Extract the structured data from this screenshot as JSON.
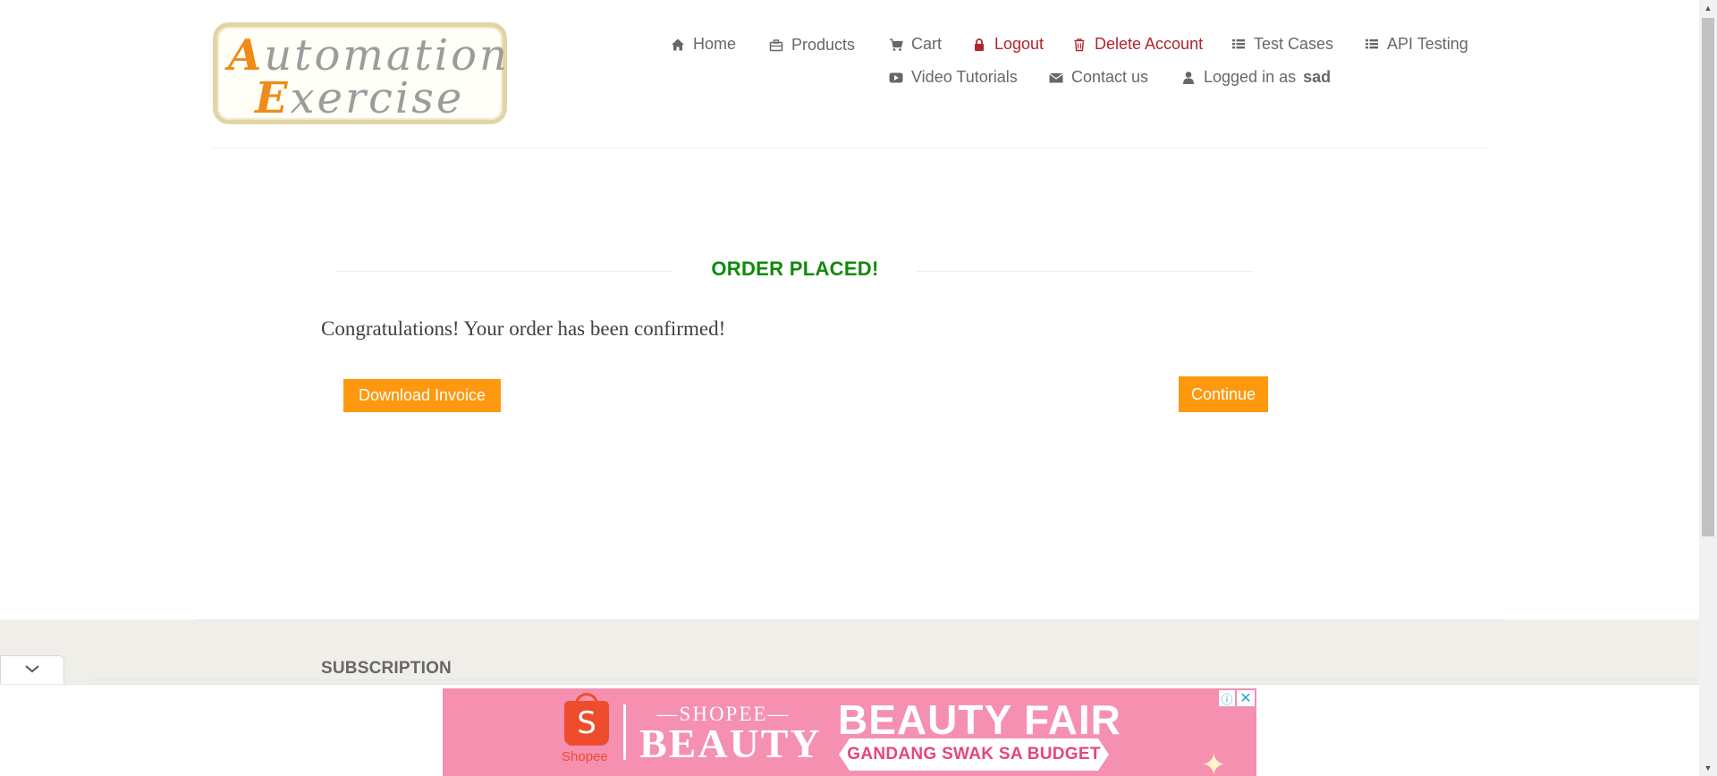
{
  "logo": {
    "line1_cap": "A",
    "line1_rest": "utomation",
    "line2_cap": "E",
    "line2_rest": "xercise"
  },
  "nav": {
    "home": "Home",
    "products": "Products",
    "cart": "Cart",
    "logout": "Logout",
    "delete_account": "Delete Account",
    "test_cases": "Test Cases",
    "api_testing": "API Testing",
    "video_tutorials": "Video Tutorials",
    "contact_us": "Contact us",
    "logged_in_prefix": "Logged in as",
    "username": "sad"
  },
  "main": {
    "title": "ORDER PLACED!",
    "message": "Congratulations! Your order has been confirmed!",
    "download_invoice": "Download Invoice",
    "continue": "Continue"
  },
  "footer": {
    "subscription": "SUBSCRIPTION"
  },
  "ad": {
    "shopee_small": "Shopee",
    "bag_letter": "S",
    "shopee_top": "—SHOPEE—",
    "beauty": "BEAUTY",
    "fair": "BEAUTY FAIR",
    "tagline": "GANDANG SWAK SA BUDGET"
  },
  "colors": {
    "accent_orange": "#fe980f",
    "success_green": "#108a0a",
    "danger_red": "#b4232a",
    "ad_pink": "#f590b0",
    "footer_bg": "#efeee9"
  },
  "icons": {
    "home": "home-icon",
    "products": "briefcase-icon",
    "cart": "cart-icon",
    "logout": "lock-icon",
    "delete": "trash-icon",
    "test_cases": "list-icon",
    "api_testing": "list-icon",
    "video": "youtube-play-icon",
    "contact": "envelope-icon",
    "user": "user-icon"
  }
}
